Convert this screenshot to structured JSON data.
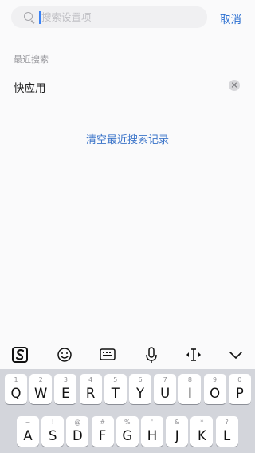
{
  "search": {
    "placeholder": "搜索设置项",
    "value": "",
    "cancel_label": "取消"
  },
  "recent": {
    "title": "最近搜索",
    "items": [
      {
        "label": "快应用"
      }
    ],
    "clear_label": "清空最近搜索记录"
  },
  "keyboard": {
    "toolbar_icons": [
      "sogou-logo-icon",
      "emoji-icon",
      "keyboard-icon",
      "microphone-icon",
      "cursor-move-icon",
      "collapse-keyboard-icon"
    ],
    "row1": [
      {
        "top": "1",
        "main": "Q"
      },
      {
        "top": "2",
        "main": "W"
      },
      {
        "top": "3",
        "main": "E"
      },
      {
        "top": "4",
        "main": "R"
      },
      {
        "top": "5",
        "main": "T"
      },
      {
        "top": "6",
        "main": "Y"
      },
      {
        "top": "7",
        "main": "U"
      },
      {
        "top": "8",
        "main": "I"
      },
      {
        "top": "9",
        "main": "O"
      },
      {
        "top": "0",
        "main": "P"
      }
    ],
    "row2": [
      {
        "top": "~",
        "main": "A"
      },
      {
        "top": "!",
        "main": "S"
      },
      {
        "top": "@",
        "main": "D"
      },
      {
        "top": "#",
        "main": "F"
      },
      {
        "top": "%",
        "main": "G"
      },
      {
        "top": "'",
        "main": "H"
      },
      {
        "top": "&",
        "main": "J"
      },
      {
        "top": "*",
        "main": "K"
      },
      {
        "top": "?",
        "main": "L"
      }
    ]
  }
}
